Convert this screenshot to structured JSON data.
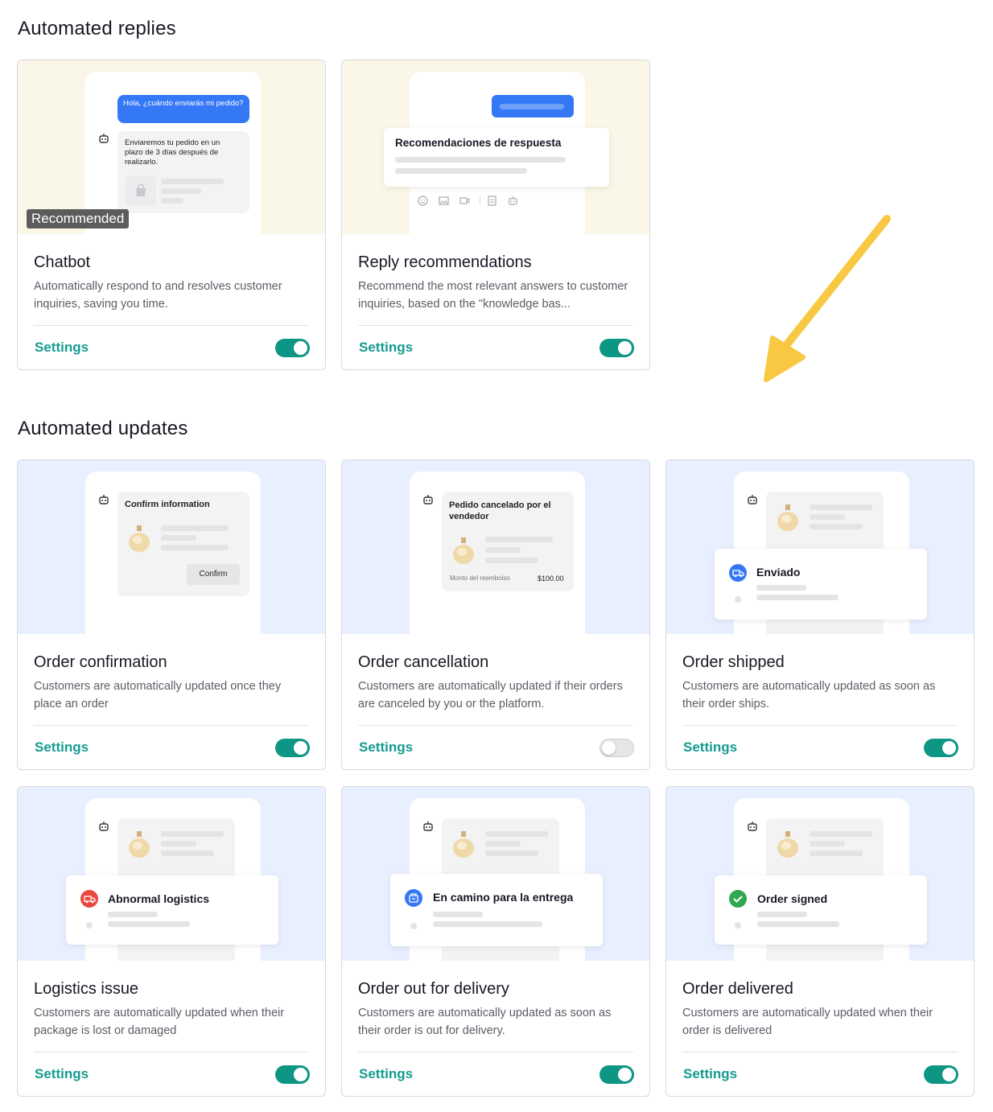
{
  "sections": {
    "replies_title": "Automated replies",
    "updates_title": "Automated updates"
  },
  "settings_label": "Settings",
  "colors": {
    "accent": "#149b8f",
    "toggle_on": "#0e9684",
    "arrow": "#f8c843"
  },
  "cards": {
    "chatbot": {
      "title": "Chatbot",
      "desc": "Automatically respond to and resolves customer inquiries, saving you time.",
      "badge": "Recommended",
      "enabled": true,
      "illus": {
        "question": "Hola, ¿cuándo enviarás mi pedido?",
        "answer": "Enviaremos tu pedido en un plazo de 3 días después de realizarlo."
      }
    },
    "reply_recs": {
      "title": "Reply recommendations",
      "desc": "Recommend the most relevant answers to customer inquiries, based on the \"knowledge bas...",
      "enabled": true,
      "illus": {
        "heading": "Recomendaciones de respuesta"
      }
    },
    "order_confirmation": {
      "title": "Order confirmation",
      "desc": "Customers are automatically updated once they place an order",
      "enabled": true,
      "illus": {
        "heading": "Confirm information",
        "button": "Confirm"
      }
    },
    "order_cancellation": {
      "title": "Order cancellation",
      "desc": "Customers are automatically updated if their orders are canceled by you or the platform.",
      "enabled": false,
      "illus": {
        "heading": "Pedido cancelado por el vendedor",
        "refund_label": "Monto del reembolso",
        "refund_value": "$100.00"
      }
    },
    "order_shipped": {
      "title": "Order shipped",
      "desc": "Customers are automatically updated as soon as their order ships.",
      "enabled": true,
      "illus": {
        "status": "Enviado"
      }
    },
    "logistics_issue": {
      "title": "Logistics issue",
      "desc": "Customers are automatically updated when their package is lost or damaged",
      "enabled": true,
      "illus": {
        "status": "Abnormal logistics"
      }
    },
    "out_for_delivery": {
      "title": "Order out for delivery",
      "desc": "Customers are automatically updated as soon as their order is out for delivery.",
      "enabled": true,
      "illus": {
        "status": "En camino para la entrega"
      }
    },
    "order_delivered": {
      "title": "Order delivered",
      "desc": "Customers are automatically updated when their order is delivered",
      "enabled": true,
      "illus": {
        "status": "Order signed"
      }
    }
  }
}
